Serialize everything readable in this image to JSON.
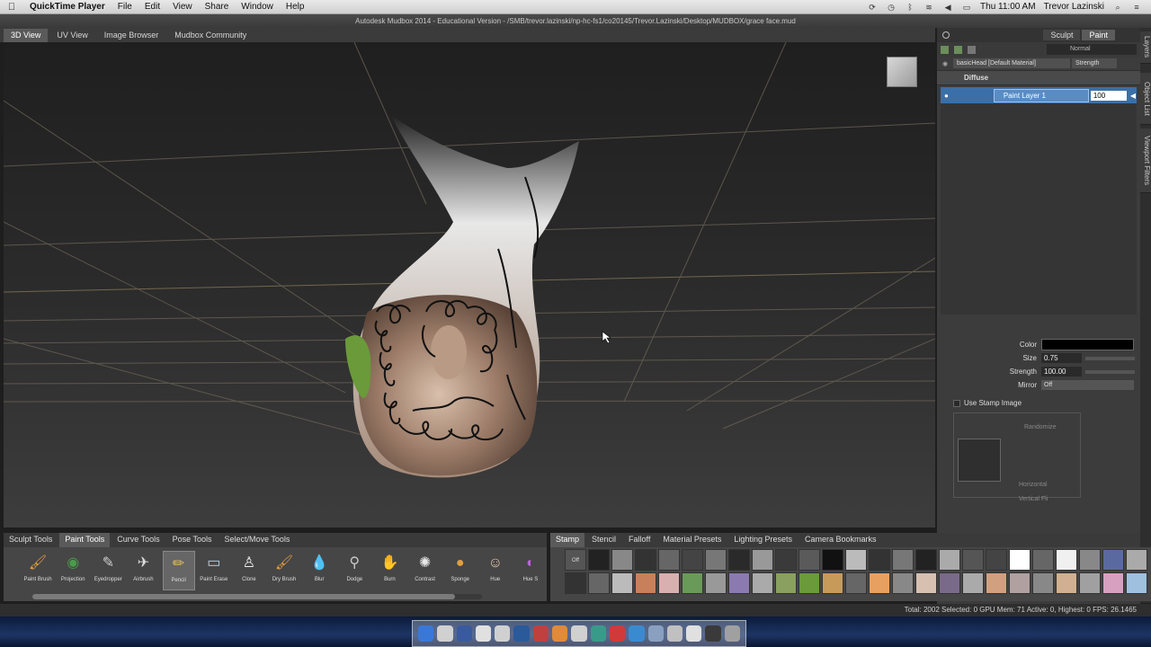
{
  "menubar": {
    "apple_icon": "apple-icon",
    "app_name": "QuickTime Player",
    "items": [
      "File",
      "Edit",
      "View",
      "Share",
      "Window",
      "Help"
    ],
    "clock": "Thu 11:00 AM",
    "user": "Trevor Lazinski"
  },
  "window": {
    "title": "Autodesk Mudbox 2014 - Educational Version - /SMB/trevor.lazinski/np-hc-fs1/co20145/Trevor.Lazinski/Desktop/MUDBOX/grace face.mud"
  },
  "viewport_tabs": [
    "3D View",
    "UV View",
    "Image Browser",
    "Mudbox Community"
  ],
  "right_panel": {
    "mode_tabs": [
      "Sculpt",
      "Paint"
    ],
    "blend_mode": "Normal",
    "material": "basicHead [Default Material]",
    "strength_header": "Strength",
    "channel": "Diffuse",
    "layer_name": "Paint Layer 1",
    "layer_value": "100",
    "props": {
      "color_label": "Color",
      "size_label": "Size",
      "size_value": "0.75",
      "strength_label": "Strength",
      "strength_value": "100.00",
      "mirror_label": "Mirror",
      "mirror_value": "Off"
    },
    "use_stamp": "Use Stamp Image",
    "randomize": "Randomize",
    "horizontal": "Horizontal",
    "vertical_flip": "Vertical Fli"
  },
  "side_tabs": [
    "Layers",
    "Object List",
    "Viewport Filters"
  ],
  "tool_tabs": [
    "Sculpt Tools",
    "Paint Tools",
    "Curve Tools",
    "Pose Tools",
    "Select/Move Tools"
  ],
  "tools": [
    {
      "name": "Paint Brush",
      "icon": "paint-brush-icon",
      "glyph": "🖌"
    },
    {
      "name": "Projection",
      "icon": "projection-icon",
      "glyph": "◉"
    },
    {
      "name": "Eyedropper",
      "icon": "eyedropper-icon",
      "glyph": "✎"
    },
    {
      "name": "Airbrush",
      "icon": "airbrush-icon",
      "glyph": "✈"
    },
    {
      "name": "Pencil",
      "icon": "pencil-icon",
      "glyph": "✏"
    },
    {
      "name": "Paint Erase",
      "icon": "eraser-icon",
      "glyph": "▭"
    },
    {
      "name": "Clone",
      "icon": "clone-icon",
      "glyph": "♙"
    },
    {
      "name": "Dry Brush",
      "icon": "dry-brush-icon",
      "glyph": "🖌"
    },
    {
      "name": "Blur",
      "icon": "blur-icon",
      "glyph": "💧"
    },
    {
      "name": "Dodge",
      "icon": "dodge-icon",
      "glyph": "⚲"
    },
    {
      "name": "Burn",
      "icon": "burn-icon",
      "glyph": "✋"
    },
    {
      "name": "Contrast",
      "icon": "contrast-icon",
      "glyph": "✺"
    },
    {
      "name": "Sponge",
      "icon": "sponge-icon",
      "glyph": "●"
    },
    {
      "name": "Hue",
      "icon": "hue-icon",
      "glyph": "☺"
    },
    {
      "name": "Hue S",
      "icon": "hue-shift-icon",
      "glyph": "◐"
    }
  ],
  "tray_tabs_right": [
    "Stamp",
    "Stencil",
    "Falloff",
    "Material Presets",
    "Lighting Presets",
    "Camera Bookmarks"
  ],
  "stamp_off_label": "Off",
  "status": {
    "text": "Total: 2002  Selected: 0  GPU Mem: 71  Active: 0, Highest: 0  FPS: 26.1465"
  },
  "colors": {
    "accent": "#3b6fa8",
    "skin": "#9c7c68",
    "grid": "#8a7a5a"
  }
}
